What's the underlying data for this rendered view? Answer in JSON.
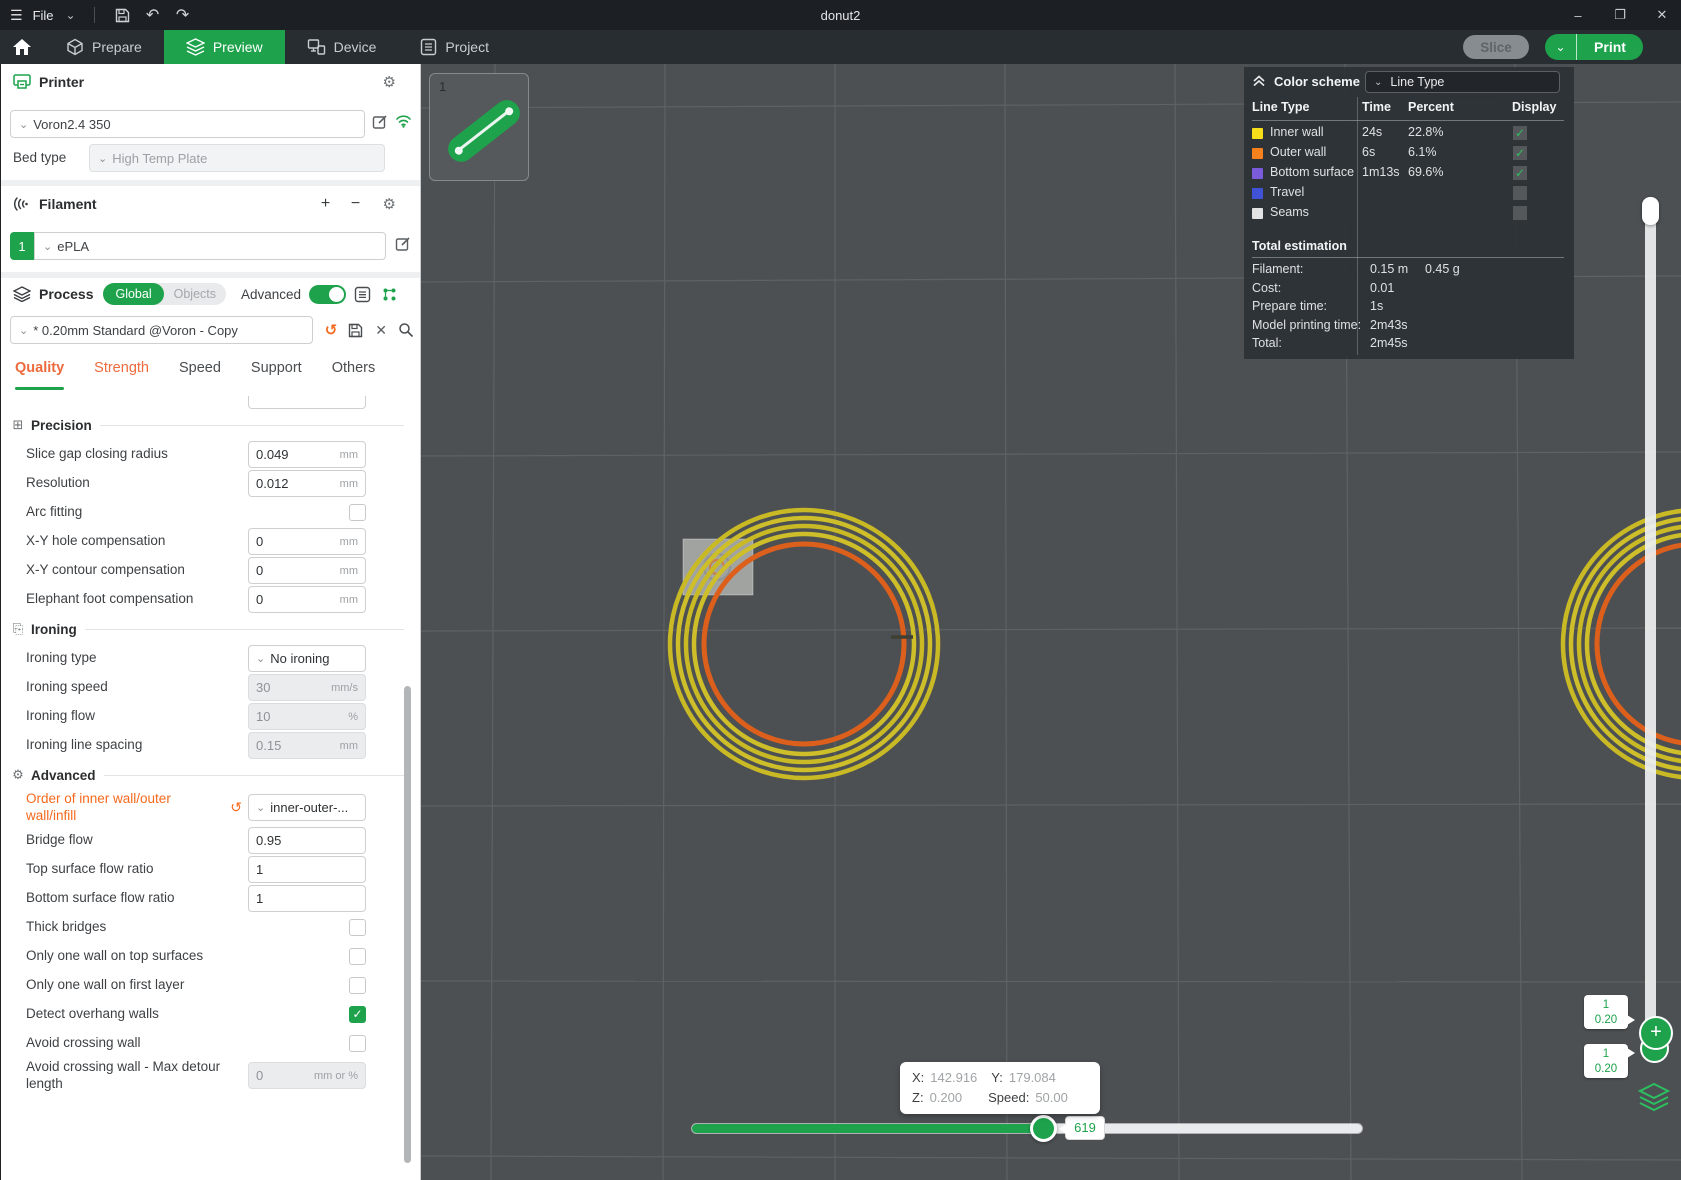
{
  "window": {
    "title": "donut2",
    "file_label": "File"
  },
  "tabbar": {
    "prepare": "Prepare",
    "preview": "Preview",
    "device": "Device",
    "project": "Project",
    "slice": "Slice",
    "print": "Print"
  },
  "printer": {
    "title": "Printer",
    "preset": "Voron2.4 350",
    "bed_type_label": "Bed type",
    "bed_type": "High Temp Plate"
  },
  "filament": {
    "title": "Filament",
    "slot": "1",
    "preset": "ePLA"
  },
  "process": {
    "title": "Process",
    "scope_global": "Global",
    "scope_objects": "Objects",
    "advanced_label": "Advanced",
    "preset": "* 0.20mm Standard @Voron - Copy",
    "tabs": [
      {
        "label": "Quality",
        "state": "active"
      },
      {
        "label": "Strength",
        "state": "modified"
      },
      {
        "label": "Speed",
        "state": ""
      },
      {
        "label": "Support",
        "state": ""
      },
      {
        "label": "Others",
        "state": ""
      }
    ]
  },
  "settings_sections": [
    {
      "title": "Precision",
      "icon": "precision-icon",
      "rows": [
        {
          "label": "Slice gap closing radius",
          "control": "input",
          "value": "0.049",
          "unit": "mm"
        },
        {
          "label": "Resolution",
          "control": "input",
          "value": "0.012",
          "unit": "mm"
        },
        {
          "label": "Arc fitting",
          "control": "checkbox",
          "checked": false
        },
        {
          "label": "X-Y hole compensation",
          "control": "input",
          "value": "0",
          "unit": "mm"
        },
        {
          "label": "X-Y contour compensation",
          "control": "input",
          "value": "0",
          "unit": "mm"
        },
        {
          "label": "Elephant foot compensation",
          "control": "input",
          "value": "0",
          "unit": "mm"
        }
      ]
    },
    {
      "title": "Ironing",
      "icon": "ironing-icon",
      "rows": [
        {
          "label": "Ironing type",
          "control": "select",
          "value": "No ironing"
        },
        {
          "label": "Ironing speed",
          "control": "input",
          "value": "30",
          "unit": "mm/s",
          "disabled": true
        },
        {
          "label": "Ironing flow",
          "control": "input",
          "value": "10",
          "unit": "%",
          "disabled": true
        },
        {
          "label": "Ironing line spacing",
          "control": "input",
          "value": "0.15",
          "unit": "mm",
          "disabled": true
        }
      ]
    },
    {
      "title": "Advanced",
      "icon": "advanced-icon",
      "rows": [
        {
          "label": "Order of inner wall/outer wall/infill",
          "control": "select",
          "value": "inner-outer-...",
          "modified": true
        },
        {
          "label": "Bridge flow",
          "control": "input",
          "value": "0.95"
        },
        {
          "label": "Top surface flow ratio",
          "control": "input",
          "value": "1"
        },
        {
          "label": "Bottom surface flow ratio",
          "control": "input",
          "value": "1"
        },
        {
          "label": "Thick bridges",
          "control": "checkbox",
          "checked": false
        },
        {
          "label": "Only one wall on top surfaces",
          "control": "checkbox",
          "checked": false
        },
        {
          "label": "Only one wall on first layer",
          "control": "checkbox",
          "checked": false
        },
        {
          "label": "Detect overhang walls",
          "control": "checkbox",
          "checked": true
        },
        {
          "label": "Avoid crossing wall",
          "control": "checkbox",
          "checked": false
        },
        {
          "label": "Avoid crossing wall - Max detour length",
          "control": "input",
          "value": "0",
          "unit": "mm or %",
          "disabled": true
        }
      ]
    }
  ],
  "estimation": {
    "header_title": "Color scheme",
    "view_mode": "Line Type",
    "columns": [
      "Line Type",
      "Time",
      "Percent",
      "Display"
    ],
    "rows": [
      {
        "name": "Inner wall",
        "color": "#F6DE1A",
        "time": "24s",
        "percent": "22.8%",
        "display": true
      },
      {
        "name": "Outer wall",
        "color": "#F5801E",
        "time": "6s",
        "percent": "6.1%",
        "display": true
      },
      {
        "name": "Bottom surface",
        "color": "#7A5BDC",
        "time": "1m13s",
        "percent": "69.6%",
        "display": true
      },
      {
        "name": "Travel",
        "color": "#4053D6",
        "time": "",
        "percent": "",
        "display": false
      },
      {
        "name": "Seams",
        "color": "#E3E3E3",
        "time": "",
        "percent": "",
        "display": false
      }
    ],
    "totals_title": "Total estimation",
    "totals": [
      {
        "label": "Filament:",
        "value": "0.15 m",
        "value2": "0.45 g"
      },
      {
        "label": "Cost:",
        "value": "0.01"
      },
      {
        "label": "Prepare time:",
        "value": "1s"
      },
      {
        "label": "Model printing time:",
        "value": "2m43s"
      },
      {
        "label": "Total:",
        "value": "2m45s"
      }
    ]
  },
  "layer_slider": {
    "badges": [
      {
        "layer": "1",
        "height": "0.20"
      },
      {
        "layer": "1",
        "height": "0.20"
      }
    ]
  },
  "move_slider": {
    "value": "619"
  },
  "tooltip": {
    "x_label": "X:",
    "x": "142.916",
    "y_label": "Y:",
    "y": "179.084",
    "z_label": "Z:",
    "z": "0.200",
    "speed_label": "Speed:",
    "speed": "50.00"
  },
  "thumbnail": {
    "number": "1"
  },
  "colors": {
    "accent": "#1EA34C",
    "inner_wall_line": "#C9BA25",
    "outer_wall_line": "#DD5F1C"
  }
}
